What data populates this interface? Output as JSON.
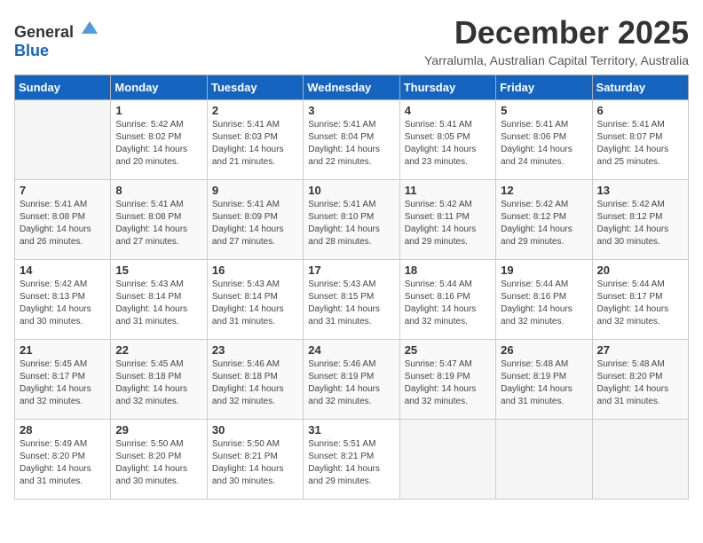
{
  "logo": {
    "general": "General",
    "blue": "Blue"
  },
  "title": "December 2025",
  "subtitle": "Yarralumla, Australian Capital Territory, Australia",
  "headers": [
    "Sunday",
    "Monday",
    "Tuesday",
    "Wednesday",
    "Thursday",
    "Friday",
    "Saturday"
  ],
  "weeks": [
    [
      {
        "day": "",
        "detail": ""
      },
      {
        "day": "1",
        "detail": "Sunrise: 5:42 AM\nSunset: 8:02 PM\nDaylight: 14 hours\nand 20 minutes."
      },
      {
        "day": "2",
        "detail": "Sunrise: 5:41 AM\nSunset: 8:03 PM\nDaylight: 14 hours\nand 21 minutes."
      },
      {
        "day": "3",
        "detail": "Sunrise: 5:41 AM\nSunset: 8:04 PM\nDaylight: 14 hours\nand 22 minutes."
      },
      {
        "day": "4",
        "detail": "Sunrise: 5:41 AM\nSunset: 8:05 PM\nDaylight: 14 hours\nand 23 minutes."
      },
      {
        "day": "5",
        "detail": "Sunrise: 5:41 AM\nSunset: 8:06 PM\nDaylight: 14 hours\nand 24 minutes."
      },
      {
        "day": "6",
        "detail": "Sunrise: 5:41 AM\nSunset: 8:07 PM\nDaylight: 14 hours\nand 25 minutes."
      }
    ],
    [
      {
        "day": "7",
        "detail": "Sunrise: 5:41 AM\nSunset: 8:08 PM\nDaylight: 14 hours\nand 26 minutes."
      },
      {
        "day": "8",
        "detail": "Sunrise: 5:41 AM\nSunset: 8:08 PM\nDaylight: 14 hours\nand 27 minutes."
      },
      {
        "day": "9",
        "detail": "Sunrise: 5:41 AM\nSunset: 8:09 PM\nDaylight: 14 hours\nand 27 minutes."
      },
      {
        "day": "10",
        "detail": "Sunrise: 5:41 AM\nSunset: 8:10 PM\nDaylight: 14 hours\nand 28 minutes."
      },
      {
        "day": "11",
        "detail": "Sunrise: 5:42 AM\nSunset: 8:11 PM\nDaylight: 14 hours\nand 29 minutes."
      },
      {
        "day": "12",
        "detail": "Sunrise: 5:42 AM\nSunset: 8:12 PM\nDaylight: 14 hours\nand 29 minutes."
      },
      {
        "day": "13",
        "detail": "Sunrise: 5:42 AM\nSunset: 8:12 PM\nDaylight: 14 hours\nand 30 minutes."
      }
    ],
    [
      {
        "day": "14",
        "detail": "Sunrise: 5:42 AM\nSunset: 8:13 PM\nDaylight: 14 hours\nand 30 minutes."
      },
      {
        "day": "15",
        "detail": "Sunrise: 5:43 AM\nSunset: 8:14 PM\nDaylight: 14 hours\nand 31 minutes."
      },
      {
        "day": "16",
        "detail": "Sunrise: 5:43 AM\nSunset: 8:14 PM\nDaylight: 14 hours\nand 31 minutes."
      },
      {
        "day": "17",
        "detail": "Sunrise: 5:43 AM\nSunset: 8:15 PM\nDaylight: 14 hours\nand 31 minutes."
      },
      {
        "day": "18",
        "detail": "Sunrise: 5:44 AM\nSunset: 8:16 PM\nDaylight: 14 hours\nand 32 minutes."
      },
      {
        "day": "19",
        "detail": "Sunrise: 5:44 AM\nSunset: 8:16 PM\nDaylight: 14 hours\nand 32 minutes."
      },
      {
        "day": "20",
        "detail": "Sunrise: 5:44 AM\nSunset: 8:17 PM\nDaylight: 14 hours\nand 32 minutes."
      }
    ],
    [
      {
        "day": "21",
        "detail": "Sunrise: 5:45 AM\nSunset: 8:17 PM\nDaylight: 14 hours\nand 32 minutes."
      },
      {
        "day": "22",
        "detail": "Sunrise: 5:45 AM\nSunset: 8:18 PM\nDaylight: 14 hours\nand 32 minutes."
      },
      {
        "day": "23",
        "detail": "Sunrise: 5:46 AM\nSunset: 8:18 PM\nDaylight: 14 hours\nand 32 minutes."
      },
      {
        "day": "24",
        "detail": "Sunrise: 5:46 AM\nSunset: 8:19 PM\nDaylight: 14 hours\nand 32 minutes."
      },
      {
        "day": "25",
        "detail": "Sunrise: 5:47 AM\nSunset: 8:19 PM\nDaylight: 14 hours\nand 32 minutes."
      },
      {
        "day": "26",
        "detail": "Sunrise: 5:48 AM\nSunset: 8:19 PM\nDaylight: 14 hours\nand 31 minutes."
      },
      {
        "day": "27",
        "detail": "Sunrise: 5:48 AM\nSunset: 8:20 PM\nDaylight: 14 hours\nand 31 minutes."
      }
    ],
    [
      {
        "day": "28",
        "detail": "Sunrise: 5:49 AM\nSunset: 8:20 PM\nDaylight: 14 hours\nand 31 minutes."
      },
      {
        "day": "29",
        "detail": "Sunrise: 5:50 AM\nSunset: 8:20 PM\nDaylight: 14 hours\nand 30 minutes."
      },
      {
        "day": "30",
        "detail": "Sunrise: 5:50 AM\nSunset: 8:21 PM\nDaylight: 14 hours\nand 30 minutes."
      },
      {
        "day": "31",
        "detail": "Sunrise: 5:51 AM\nSunset: 8:21 PM\nDaylight: 14 hours\nand 29 minutes."
      },
      {
        "day": "",
        "detail": ""
      },
      {
        "day": "",
        "detail": ""
      },
      {
        "day": "",
        "detail": ""
      }
    ]
  ]
}
